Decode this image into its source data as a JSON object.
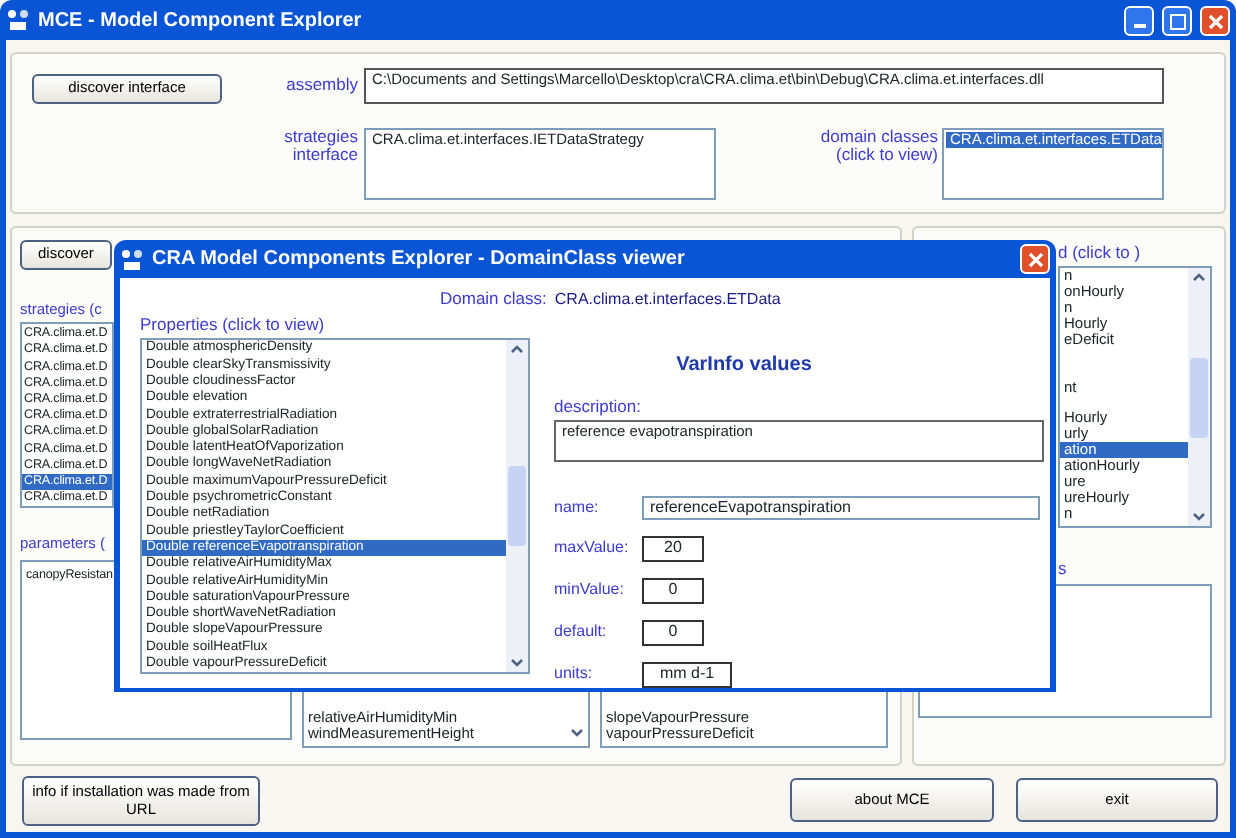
{
  "window": {
    "title": "MCE - Model Component Explorer"
  },
  "top": {
    "discover_button": "discover interface",
    "assembly_label": "assembly",
    "assembly_path": "C:\\Documents and Settings\\Marcello\\Desktop\\cra\\CRA.clima.et\\bin\\Debug\\CRA.clima.et.interfaces.dll",
    "strategies_label": "strategies interface",
    "strategies_value": "CRA.clima.et.interfaces.IETDataStrategy",
    "domain_label": "domain classes (click to view)",
    "domain_classes": [
      {
        "text": "CRA.clima.et.interfaces.ETData",
        "selected": true
      }
    ]
  },
  "left_panel": {
    "discover_button": "discover",
    "strategies_label": "strategies (c",
    "strategies": [
      {
        "text": "CRA.clima.et.D",
        "selected": false
      },
      {
        "text": "CRA.clima.et.D",
        "selected": false
      },
      {
        "text": "CRA.clima.et.D",
        "selected": false
      },
      {
        "text": "CRA.clima.et.D",
        "selected": false
      },
      {
        "text": "CRA.clima.et.D",
        "selected": false
      },
      {
        "text": "CRA.clima.et.D",
        "selected": false
      },
      {
        "text": "CRA.clima.et.D",
        "selected": false
      },
      {
        "text": "CRA.clima.et.D",
        "selected": false
      },
      {
        "text": "CRA.clima.et.D",
        "selected": false
      },
      {
        "text": "CRA.clima.et.D",
        "selected": true
      },
      {
        "text": "CRA.clima.et.D",
        "selected": false
      }
    ],
    "parameters_label": "parameters (",
    "parameters": [
      "canopyResistan"
    ],
    "list_2": [
      "relativeAirHumidityMin",
      "windMeasurementHeight"
    ],
    "list_3": [
      "slopeVapourPressure",
      "vapourPressureDeficit"
    ]
  },
  "right_panel": {
    "label": "d (click to )",
    "items": [
      {
        "text": "n",
        "selected": false
      },
      {
        "text": "onHourly",
        "selected": false
      },
      {
        "text": "n",
        "selected": false
      },
      {
        "text": "Hourly",
        "selected": false
      },
      {
        "text": "eDeficit",
        "selected": false
      },
      {
        "selected": false
      },
      {
        "selected": false
      },
      {
        "text": "nt",
        "selected": false
      },
      {
        "selected": false
      },
      {
        "text": "Hourly",
        "selected": false
      },
      {
        "text": "urly",
        "selected": false
      },
      {
        "text": "ation",
        "selected": true
      },
      {
        "text": "ationHourly",
        "selected": false
      },
      {
        "text": "ure",
        "selected": false
      },
      {
        "text": "ureHourly",
        "selected": false
      },
      {
        "text": "n",
        "selected": false
      }
    ],
    "label_2": "s"
  },
  "buttons": {
    "info": "info if installation was made from URL",
    "about": "about MCE",
    "exit": "exit"
  },
  "dialog": {
    "title": "CRA Model Components Explorer - DomainClass viewer",
    "domain_label": "Domain class:",
    "domain_value": "CRA.clima.et.interfaces.ETData",
    "properties_label": "Properties (click to view)",
    "properties": [
      {
        "text": "Double atmosphericDensity",
        "selected": false
      },
      {
        "text": "Double clearSkyTransmissivity",
        "selected": false
      },
      {
        "text": "Double cloudinessFactor",
        "selected": false
      },
      {
        "text": "Double elevation",
        "selected": false
      },
      {
        "text": "Double extraterrestrialRadiation",
        "selected": false
      },
      {
        "text": "Double globalSolarRadiation",
        "selected": false
      },
      {
        "text": "Double latentHeatOfVaporization",
        "selected": false
      },
      {
        "text": "Double longWaveNetRadiation",
        "selected": false
      },
      {
        "text": "Double maximumVapourPressureDeficit",
        "selected": false
      },
      {
        "text": "Double psychrometricConstant",
        "selected": false
      },
      {
        "text": "Double netRadiation",
        "selected": false
      },
      {
        "text": "Double priestleyTaylorCoefficient",
        "selected": false
      },
      {
        "text": "Double referenceEvapotranspiration",
        "selected": true
      },
      {
        "text": "Double relativeAirHumidityMax",
        "selected": false
      },
      {
        "text": "Double relativeAirHumidityMin",
        "selected": false
      },
      {
        "text": "Double saturationVapourPressure",
        "selected": false
      },
      {
        "text": "Double shortWaveNetRadiation",
        "selected": false
      },
      {
        "text": "Double slopeVapourPressure",
        "selected": false
      },
      {
        "text": "Double soilHeatFlux",
        "selected": false
      },
      {
        "text": "Double vapourPressureDeficit",
        "selected": false
      }
    ],
    "heading": "VarInfo values",
    "description_label": "description:",
    "description": "reference evapotranspiration",
    "fields": [
      {
        "label": "name:",
        "value": "referenceEvapotranspiration",
        "kind": "wide"
      },
      {
        "label": "maxValue:",
        "value": "20",
        "kind": "short"
      },
      {
        "label": "minValue:",
        "value": "0",
        "kind": "short"
      },
      {
        "label": "default:",
        "value": "0",
        "kind": "short"
      },
      {
        "label": "units:",
        "value": "mm d-1",
        "kind": "medium"
      }
    ]
  }
}
